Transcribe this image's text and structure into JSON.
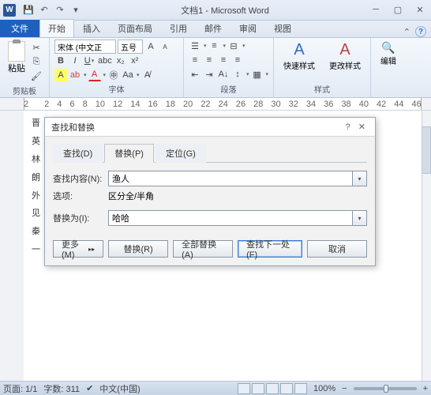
{
  "title": "文档1 - Microsoft Word",
  "tabs": {
    "file": "文件",
    "home": "开始",
    "insert": "插入",
    "layout": "页面布局",
    "ref": "引用",
    "mail": "邮件",
    "review": "审阅",
    "view": "视图"
  },
  "ribbon": {
    "paste": "粘贴",
    "clipboard": "剪贴板",
    "font": "字体",
    "para": "段落",
    "styles": "样式",
    "edit": "编辑",
    "quickstyle": "快速样式",
    "changestyle": "更改样式",
    "fontname": "宋体 (中文正",
    "fontsize": "五号"
  },
  "ruler": [
    "2",
    "",
    "2",
    "4",
    "6",
    "8",
    "10",
    "12",
    "14",
    "16",
    "18",
    "20",
    "22",
    "24",
    "26",
    "28",
    "30",
    "32",
    "34",
    "36",
    "38",
    "40",
    "42",
    "44",
    "46"
  ],
  "doc": {
    "l1": "晋",
    "l2": "英",
    "l3": "林",
    "l4": "朗",
    "l5": "外",
    "l6": "见",
    "l7": "秦",
    "l8": "一"
  },
  "dialog": {
    "title": "查找和替换",
    "tabs": {
      "find": "查找(D)",
      "replace": "替换(P)",
      "goto": "定位(G)"
    },
    "find_label": "查找内容(N):",
    "find_value": "渔人",
    "options_label": "选项:",
    "options_value": "区分全/半角",
    "replace_label": "替换为(I):",
    "replace_value": "哈哈",
    "more": "更多(M)",
    "btn_replace": "替换(R)",
    "btn_replaceall": "全部替换(A)",
    "btn_findnext": "查找下一处(F)",
    "btn_cancel": "取消"
  },
  "status": {
    "page": "页面: 1/1",
    "words": "字数: 311",
    "lang": "中文(中国)",
    "zoom": "100%"
  }
}
